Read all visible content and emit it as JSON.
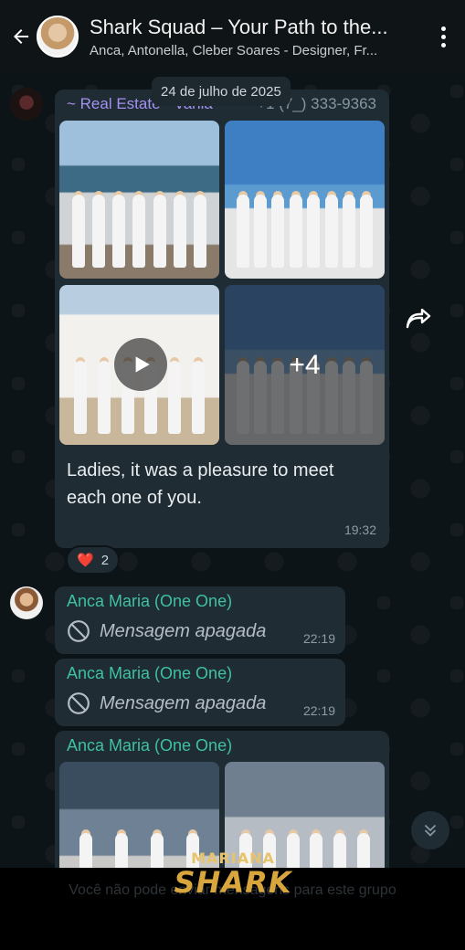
{
  "header": {
    "title": "Shark Squad – Your Path to the...",
    "subtitle": "Anca, Antonella, Cleber Soares - Designer, Fr..."
  },
  "date_chip": "24 de julho de 2025",
  "message_1": {
    "sender": "~ Real Estate - Vania",
    "phone": "+1 (7_) 333-9363",
    "more_count": "+4",
    "text": "Ladies, it was a pleasure to meet each one of you.",
    "time": "19:32",
    "reaction": {
      "emoji": "❤️",
      "count": "2"
    }
  },
  "deleted_messages": [
    {
      "sender": "Anca Maria (One One)",
      "text": "Mensagem apagada",
      "time": "22:19"
    },
    {
      "sender": "Anca Maria (One One)",
      "text": "Mensagem apagada",
      "time": "22:19"
    }
  ],
  "message_last": {
    "sender": "Anca Maria (One One)"
  },
  "footer": {
    "note": "Você não pode enviar mensagens para este grupo",
    "logo_top": "MARIANA",
    "logo_main": "SHARK"
  },
  "icons": [
    "back-arrow-icon",
    "more-vertical-icon",
    "play-icon",
    "forward-icon",
    "blocked-icon",
    "chevrons-down-icon"
  ],
  "colors": {
    "header_bg": "#0f1417",
    "bubble_bg": "#1f2c34",
    "sender_purple": "#a591f0",
    "sender_green": "#3fc1a0",
    "logo_gold": "#d9a63d"
  }
}
